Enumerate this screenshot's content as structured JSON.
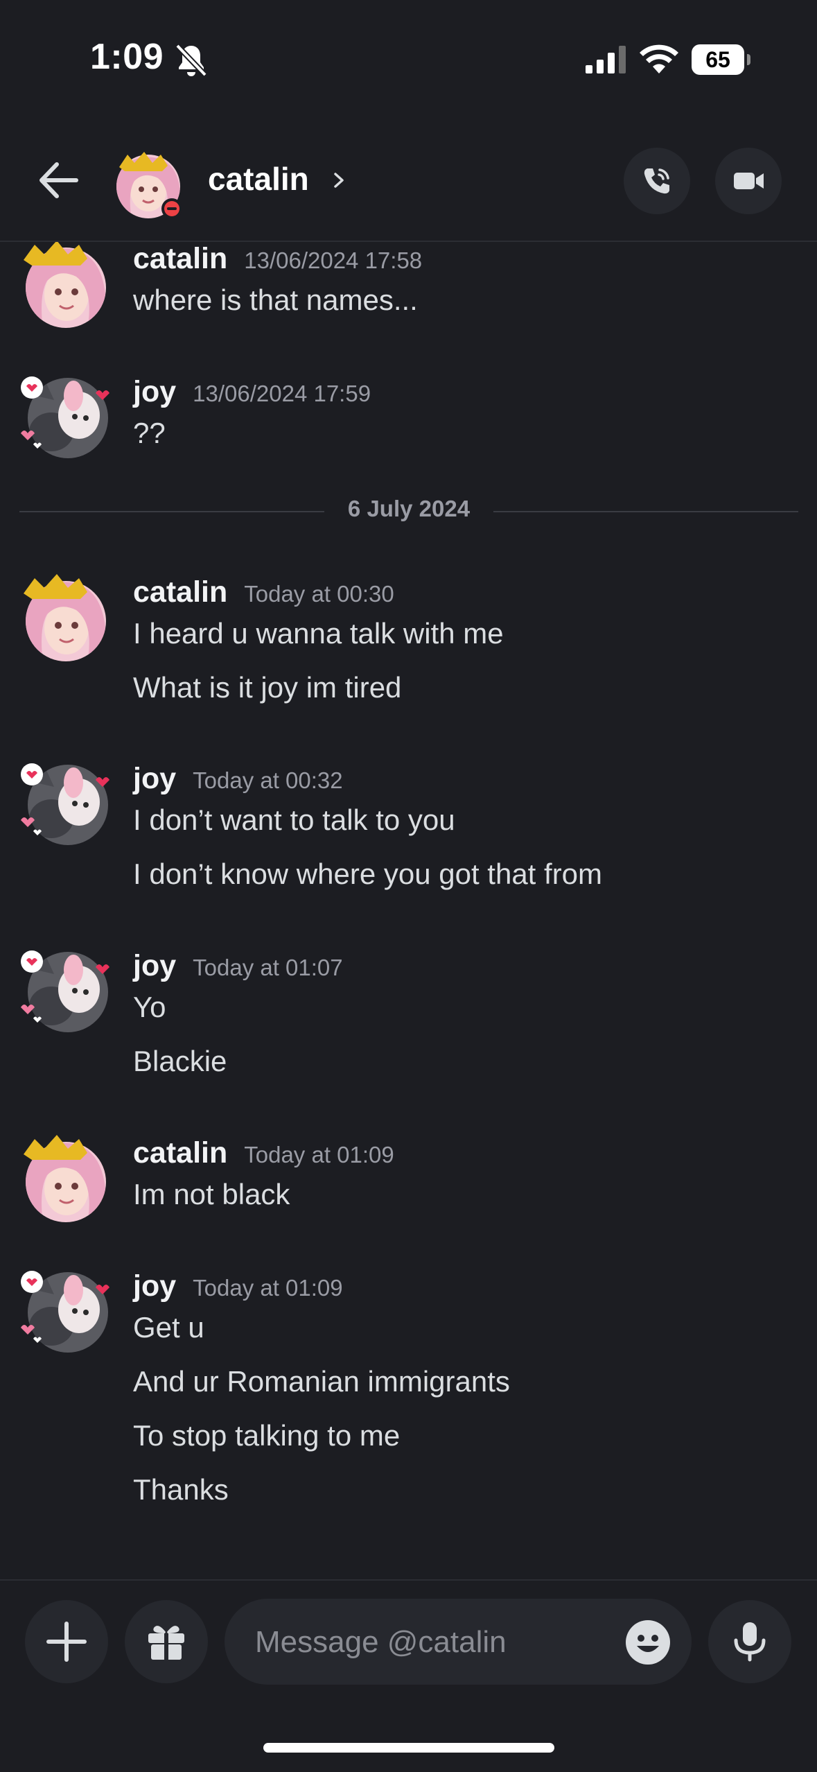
{
  "status_bar": {
    "time": "1:09",
    "battery": "65",
    "icons": [
      "bell-off-icon",
      "signal-icon",
      "wifi-icon",
      "battery-icon"
    ]
  },
  "header": {
    "title": "catalin",
    "chevron": "›",
    "back_icon": "arrow-left-icon",
    "call_icon": "phone-icon",
    "video_icon": "video-camera-icon",
    "presence": "do-not-disturb"
  },
  "messages": [
    {
      "author": "catalin",
      "timestamp": "13/06/2024 17:58",
      "lines": [
        "where is that names..."
      ]
    },
    {
      "author": "joy",
      "timestamp": "13/06/2024 17:59",
      "lines": [
        "??"
      ]
    },
    {
      "divider": "6 July 2024"
    },
    {
      "author": "catalin",
      "timestamp": "Today at 00:30",
      "lines": [
        "I heard u wanna talk with me",
        "What is it joy im tired"
      ]
    },
    {
      "author": "joy",
      "timestamp": "Today at 00:32",
      "lines": [
        "I don’t want to talk to you",
        "I don’t know where you got that from"
      ]
    },
    {
      "author": "joy",
      "timestamp": "Today at 01:07",
      "lines": [
        "Yo",
        "Blackie"
      ]
    },
    {
      "author": "catalin",
      "timestamp": "Today at 01:09",
      "lines": [
        "Im not black"
      ]
    },
    {
      "author": "joy",
      "timestamp": "Today at 01:09",
      "lines": [
        "Get u",
        "And ur Romanian immigrants",
        "To stop talking to me",
        "Thanks"
      ]
    }
  ],
  "composer": {
    "placeholder": "Message @catalin",
    "plus_icon": "plus-icon",
    "gift_icon": "gift-icon",
    "emoji_icon": "emoji-icon",
    "mic_icon": "microphone-icon"
  },
  "colors": {
    "background": "#1c1d22",
    "button_bg": "#26282e",
    "timestamp": "#9a9ca5",
    "dnd_red": "#ed4245"
  }
}
